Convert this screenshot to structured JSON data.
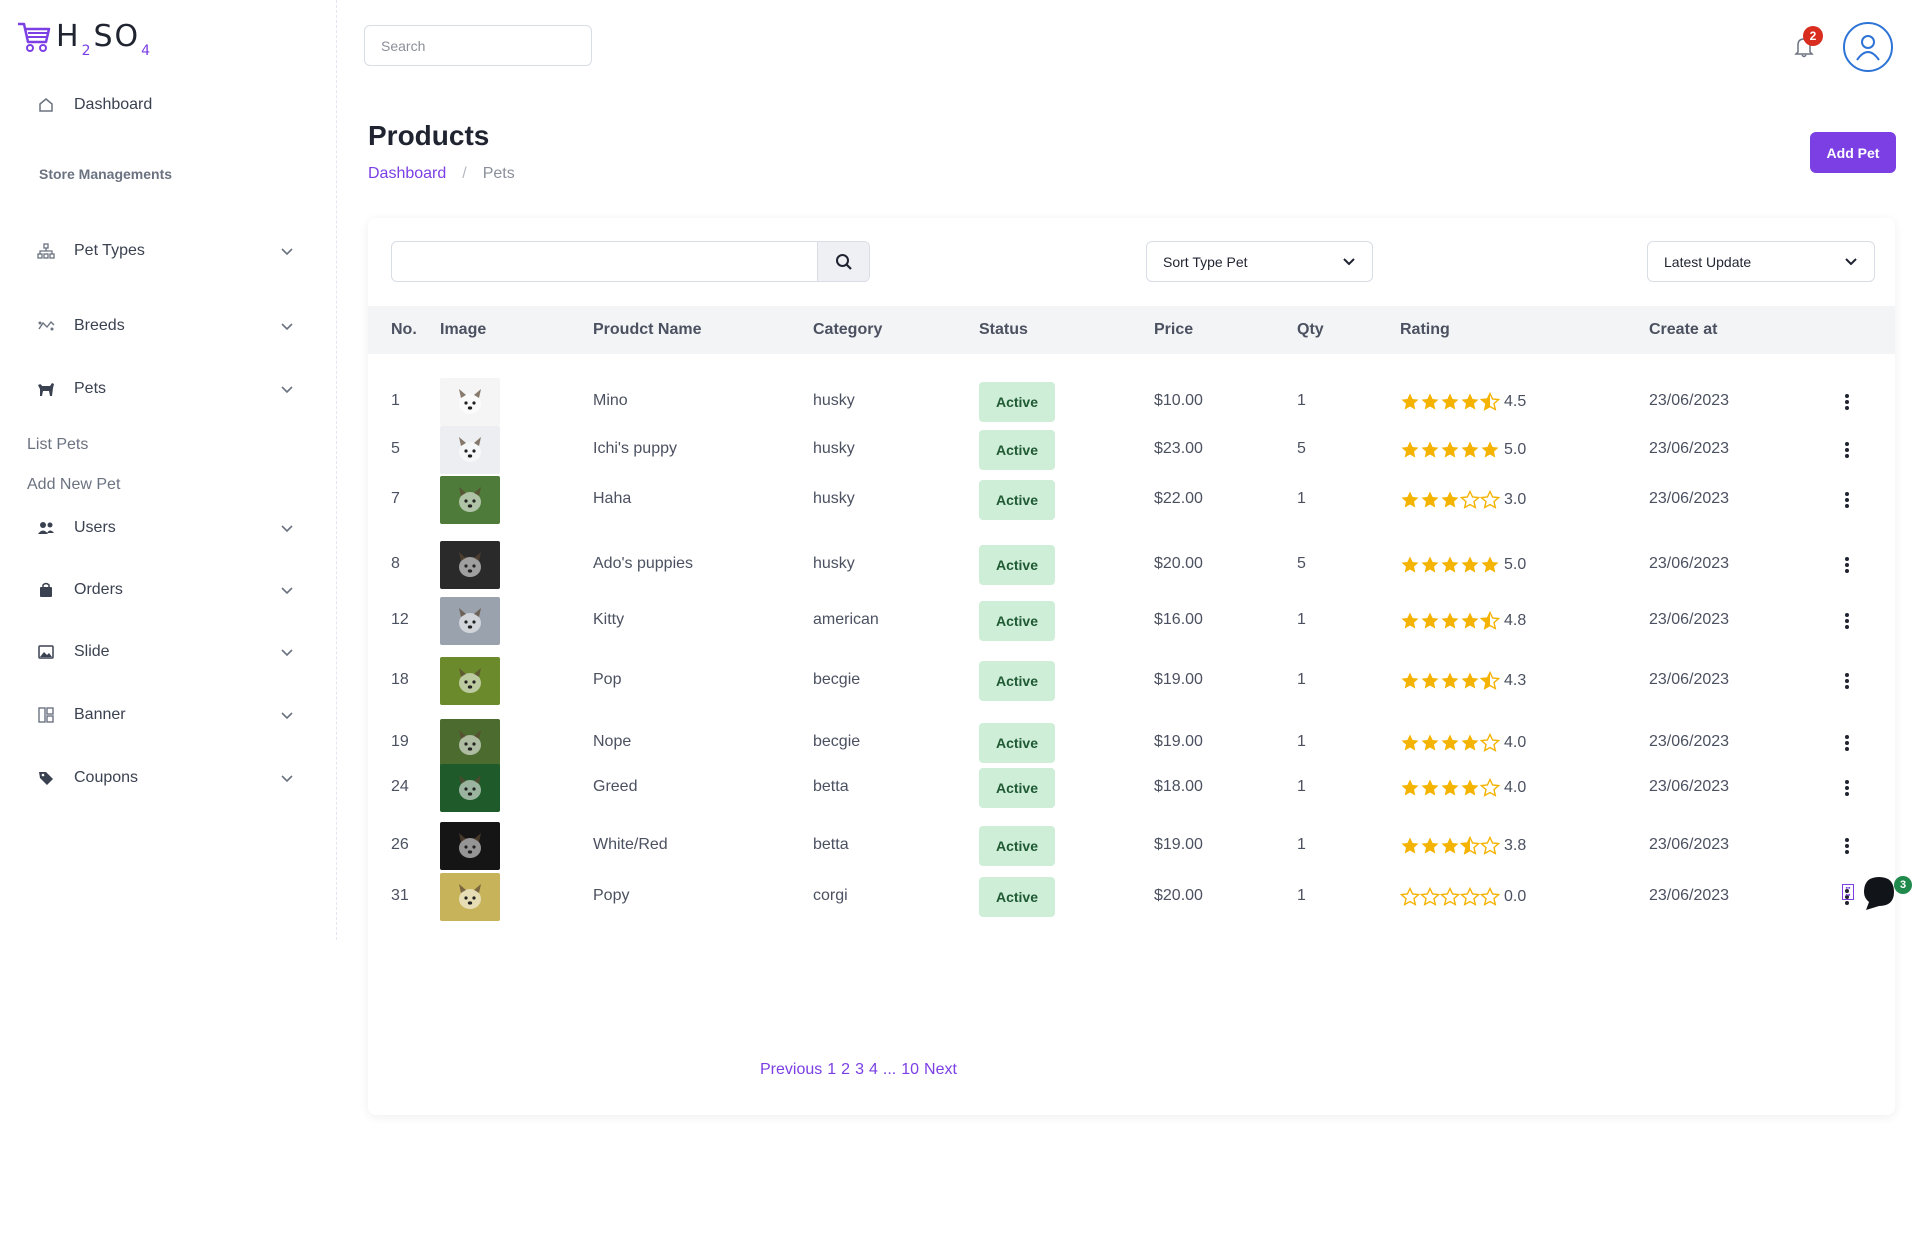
{
  "brand": {
    "letters": [
      "H",
      "2",
      "S",
      "O",
      "4"
    ]
  },
  "sidebar": {
    "dashboard": "Dashboard",
    "section": "Store Managements",
    "items": [
      {
        "label": "Pet Types",
        "icon": "sitemap-icon"
      },
      {
        "label": "Breeds",
        "icon": "breeds-icon"
      },
      {
        "label": "Pets",
        "icon": "dog-icon"
      },
      {
        "label": "Users",
        "icon": "users-icon"
      },
      {
        "label": "Orders",
        "icon": "bag-icon"
      },
      {
        "label": "Slide",
        "icon": "image-icon"
      },
      {
        "label": "Banner",
        "icon": "layout-icon"
      },
      {
        "label": "Coupons",
        "icon": "tag-icon"
      }
    ],
    "pets_sub": [
      "List Pets",
      "Add New Pet"
    ]
  },
  "header": {
    "search_placeholder": "Search",
    "notification_count": "2"
  },
  "page": {
    "title": "Products",
    "breadcrumb": [
      "Dashboard",
      "/",
      "Pets"
    ],
    "add_button": "Add Pet"
  },
  "filters": {
    "sort_type": "Sort Type Pet",
    "sort_order": "Latest Update"
  },
  "table": {
    "columns": [
      "No.",
      "Image",
      "Proudct Name",
      "Category",
      "Status",
      "Price",
      "Qty",
      "Rating",
      "Create at"
    ],
    "rows": [
      {
        "no": "1",
        "name": "Mino",
        "category": "husky",
        "status": "Active",
        "price": "$10.00",
        "qty": "1",
        "rating": 4.5,
        "rating_text": "4.5",
        "created": "23/06/2023",
        "thumb_color": "#f5f5f5"
      },
      {
        "no": "5",
        "name": "Ichi's puppy",
        "category": "husky",
        "status": "Active",
        "price": "$23.00",
        "qty": "5",
        "rating": 5.0,
        "rating_text": "5.0",
        "created": "23/06/2023",
        "thumb_color": "#eceef2"
      },
      {
        "no": "7",
        "name": "Haha",
        "category": "husky",
        "status": "Active",
        "price": "$22.00",
        "qty": "1",
        "rating": 3.0,
        "rating_text": "3.0",
        "created": "23/06/2023",
        "thumb_color": "#4e7a3a"
      },
      {
        "no": "8",
        "name": "Ado's puppies",
        "category": "husky",
        "status": "Active",
        "price": "$20.00",
        "qty": "5",
        "rating": 5.0,
        "rating_text": "5.0",
        "created": "23/06/2023",
        "thumb_color": "#2a2a2a"
      },
      {
        "no": "12",
        "name": "Kitty",
        "category": "american",
        "status": "Active",
        "price": "$16.00",
        "qty": "1",
        "rating": 4.8,
        "rating_text": "4.8",
        "created": "23/06/2023",
        "thumb_color": "#9aa3ad"
      },
      {
        "no": "18",
        "name": "Pop",
        "category": "becgie",
        "status": "Active",
        "price": "$19.00",
        "qty": "1",
        "rating": 4.3,
        "rating_text": "4.3",
        "created": "23/06/2023",
        "thumb_color": "#6b8a2c"
      },
      {
        "no": "19",
        "name": "Nope",
        "category": "becgie",
        "status": "Active",
        "price": "$19.00",
        "qty": "1",
        "rating": 4.0,
        "rating_text": "4.0",
        "created": "23/06/2023",
        "thumb_color": "#4c6b2f"
      },
      {
        "no": "24",
        "name": "Greed",
        "category": "betta",
        "status": "Active",
        "price": "$18.00",
        "qty": "1",
        "rating": 4.0,
        "rating_text": "4.0",
        "created": "23/06/2023",
        "thumb_color": "#1f5a2a"
      },
      {
        "no": "26",
        "name": "White/Red",
        "category": "betta",
        "status": "Active",
        "price": "$19.00",
        "qty": "1",
        "rating": 3.8,
        "rating_text": "3.8",
        "created": "23/06/2023",
        "thumb_color": "#151515"
      },
      {
        "no": "31",
        "name": "Popy",
        "category": "corgi",
        "status": "Active",
        "price": "$20.00",
        "qty": "1",
        "rating": 0.0,
        "rating_text": "0.0",
        "created": "23/06/2023",
        "thumb_color": "#c7b35a"
      }
    ]
  },
  "pagination": [
    "Previous",
    "1",
    "2",
    "3",
    "4",
    "...",
    "10",
    "Next"
  ],
  "chat": {
    "badge": "3"
  },
  "colors": {
    "accent": "#7b3fe4",
    "star": "#f5b301",
    "status_bg": "#cfeed8",
    "badge": "#d92d20"
  }
}
